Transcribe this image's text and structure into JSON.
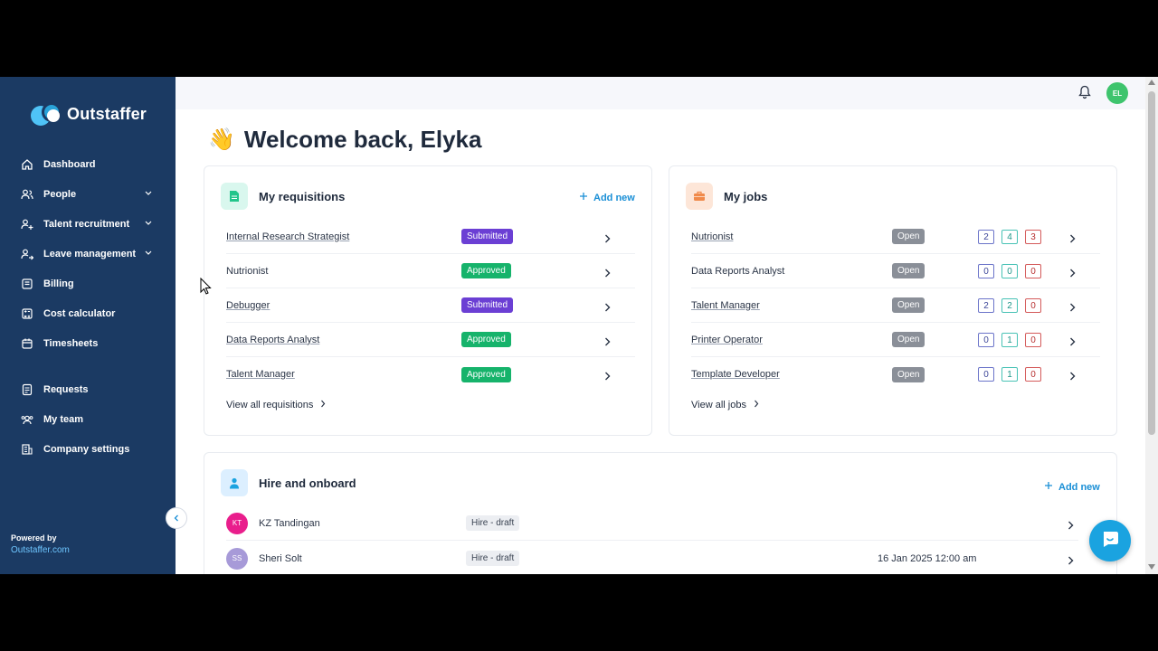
{
  "app": {
    "name": "Outstaffer"
  },
  "sidebar": {
    "items": [
      {
        "label": "Dashboard",
        "icon": "home-icon"
      },
      {
        "label": "People",
        "icon": "people-icon",
        "expandable": true
      },
      {
        "label": "Talent recruitment",
        "icon": "recruit-icon",
        "expandable": true
      },
      {
        "label": "Leave management",
        "icon": "leave-icon",
        "expandable": true
      },
      {
        "label": "Billing",
        "icon": "billing-icon"
      },
      {
        "label": "Cost calculator",
        "icon": "calculator-icon"
      },
      {
        "label": "Timesheets",
        "icon": "calendar-icon"
      }
    ],
    "items2": [
      {
        "label": "Requests",
        "icon": "requests-icon"
      },
      {
        "label": "My team",
        "icon": "team-icon"
      },
      {
        "label": "Company settings",
        "icon": "building-icon"
      }
    ],
    "powered_by": "Powered by",
    "powered_link": "Outstaffer.com"
  },
  "topbar": {
    "avatar_initials": "EL"
  },
  "welcome": {
    "title": "Welcome back, Elyka"
  },
  "requisitions": {
    "title": "My requisitions",
    "add_new": "Add new",
    "rows": [
      {
        "name": "Internal Research Strategist",
        "status": "Submitted",
        "link": true
      },
      {
        "name": "Nutrionist",
        "status": "Approved",
        "link": false
      },
      {
        "name": "Debugger",
        "status": "Submitted",
        "link": true
      },
      {
        "name": "Data Reports Analyst",
        "status": "Approved",
        "link": true
      },
      {
        "name": "Talent Manager",
        "status": "Approved",
        "link": true
      }
    ],
    "view_all": "View all requisitions"
  },
  "jobs": {
    "title": "My jobs",
    "rows": [
      {
        "name": "Nutrionist",
        "status": "Open",
        "counts": [
          "2",
          "4",
          "3"
        ],
        "link": true
      },
      {
        "name": "Data Reports Analyst",
        "status": "Open",
        "counts": [
          "0",
          "0",
          "0"
        ],
        "link": false
      },
      {
        "name": "Talent Manager",
        "status": "Open",
        "counts": [
          "2",
          "2",
          "0"
        ],
        "link": true
      },
      {
        "name": "Printer Operator",
        "status": "Open",
        "counts": [
          "0",
          "1",
          "0"
        ],
        "link": true
      },
      {
        "name": "Template Developer",
        "status": "Open",
        "counts": [
          "0",
          "1",
          "0"
        ],
        "link": true
      }
    ],
    "view_all": "View all jobs"
  },
  "hire": {
    "title": "Hire and onboard",
    "add_new": "Add new",
    "rows": [
      {
        "initials": "KT",
        "name": "KZ Tandingan",
        "status": "Hire - draft",
        "date": "",
        "avatar_color": "#e91e8c"
      },
      {
        "initials": "SS",
        "name": "Sheri Solt",
        "status": "Hire - draft",
        "date": "16 Jan 2025 12:00 am",
        "avatar_color": "#a79ad8"
      }
    ]
  },
  "colors": {
    "sidebar": "#1b3a63",
    "accent": "#1a8fd6",
    "submitted": "#6b3fd4",
    "approved": "#16b36b"
  }
}
